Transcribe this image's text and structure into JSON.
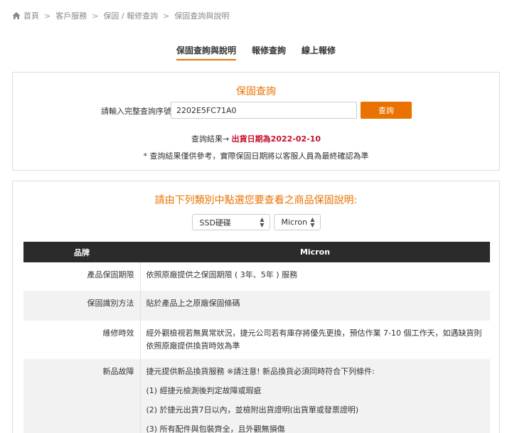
{
  "breadcrumb": {
    "items": [
      "首頁",
      "客戶服務",
      "保固 / 報修查詢",
      "保固查詢與說明"
    ]
  },
  "tabs": [
    {
      "label": "保固查詢與說明",
      "active": true
    },
    {
      "label": "報修查詢",
      "active": false
    },
    {
      "label": "線上報修",
      "active": false
    }
  ],
  "warranty_query": {
    "title": "保固查詢",
    "label": "請輸入完整查詢序號:",
    "input_value": "2202E5FC71A0",
    "button_label": "查詢",
    "result_prefix": "查詢結果→ ",
    "result_value": "出貨日期為2022-02-10",
    "note": "* 查詢結果僅供參考，實際保固日期將以客服人員為最終確認為準"
  },
  "warranty_info": {
    "title": "請由下列類別中點選您要查看之商品保固說明:",
    "category_select": "SSD硬碟",
    "brand_select": "Micron",
    "table": {
      "header_label": "品牌",
      "header_value": "Micron",
      "rows": [
        {
          "label": "產品保固期限",
          "value": "依照原廠提供之保固期限 ( 3年、5年 ) 服務"
        },
        {
          "label": "保固識別方法",
          "value": "貼於產品上之原廠保固條碼"
        },
        {
          "label": "維修時效",
          "value": "經外觀檢視若無異常狀況，捷元公司若有庫存將優先更換，預估作業 7-10 個工作天，如遇缺貨則依照原廠提供換貨時效為準"
        },
        {
          "label": "新品故障",
          "paragraphs": [
            "捷元提供新品換貨服務 ※請注意! 新品換貨必須同時符合下列條件:",
            "(1) 經捷元檢測後判定故障或瑕疵",
            "(2) 於捷元出貨7日以內，並檢附出貨證明(出貨單或發票證明)",
            "(3) 所有配件與包裝齊全，且外觀無損傷"
          ]
        }
      ]
    }
  },
  "colors": {
    "accent": "#e97200",
    "result_red": "#c8102e",
    "table_header": "#2b2b2b"
  }
}
